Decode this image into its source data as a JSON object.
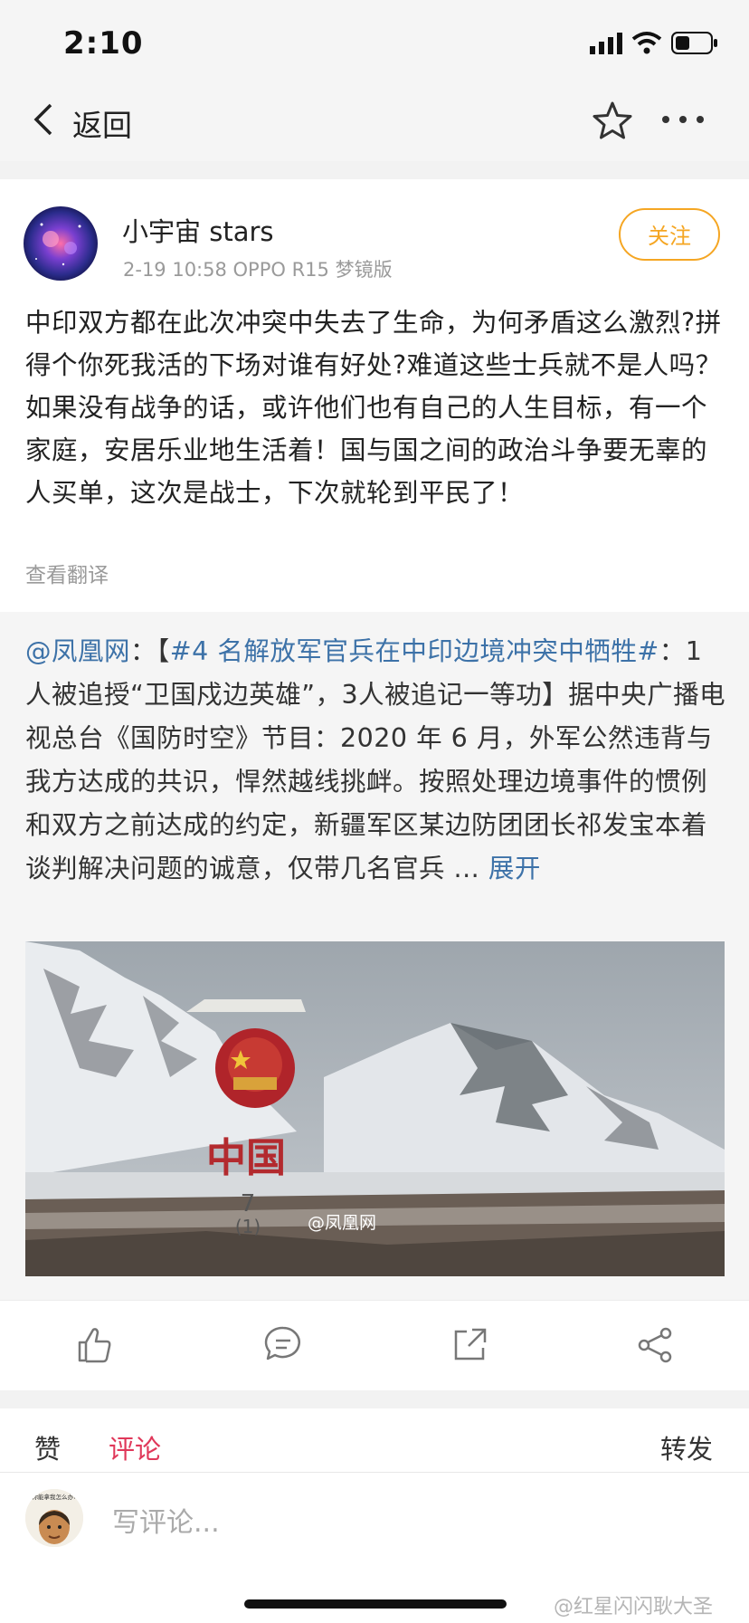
{
  "status": {
    "time": "2:10"
  },
  "nav": {
    "back_label": "返回"
  },
  "post": {
    "username": "小宇宙 stars",
    "meta": "2-19 10:58   OPPO R15 梦镜版",
    "follow_label": "关注",
    "text": "中印双方都在此次冲突中失去了生命，为何矛盾这么激烈?拼得个你死我活的下场对谁有好处?难道这些士兵就不是人吗？如果没有战争的话，或许他们也有自己的人生目标，有一个家庭，安居乐业地生活着！国与国之间的政治斗争要无辜的人买单，这次是战士，下次就轮到平民了！",
    "translate_label": "查看翻译"
  },
  "repost": {
    "mention": "@凤凰网",
    "colon": "：【",
    "topic": "#4 名解放军官兵在中印边境冲突中牺牲#",
    "body": "：1人被追授“卫国戍边英雄”，3人被追记一等功】据中央广播电视总台《国防时空》节目：2020 年 6 月，外军公然违背与我方达成的共识，悍然越线挑衅。按照处理边境事件的惯例和双方之前达成的约定，新疆军区某边防团团长祁发宝本着谈判解决问题的诚意，仅带几名官兵 ... ",
    "expand_label": "展开",
    "image": {
      "marker_text": "中国",
      "marker_number": "7",
      "marker_sub": "(1)",
      "watermark": "@凤凰网"
    }
  },
  "tabs": {
    "like": "赞",
    "comment": "评论",
    "repost": "转发"
  },
  "comment": {
    "placeholder": "写评论...",
    "avatar_caption": "你能拿我怎么办?"
  },
  "watermark": "@红星闪闪耿大圣",
  "colors": {
    "accent": "#f5a623",
    "link": "#3d72a8",
    "active_tab": "#e0385a"
  }
}
